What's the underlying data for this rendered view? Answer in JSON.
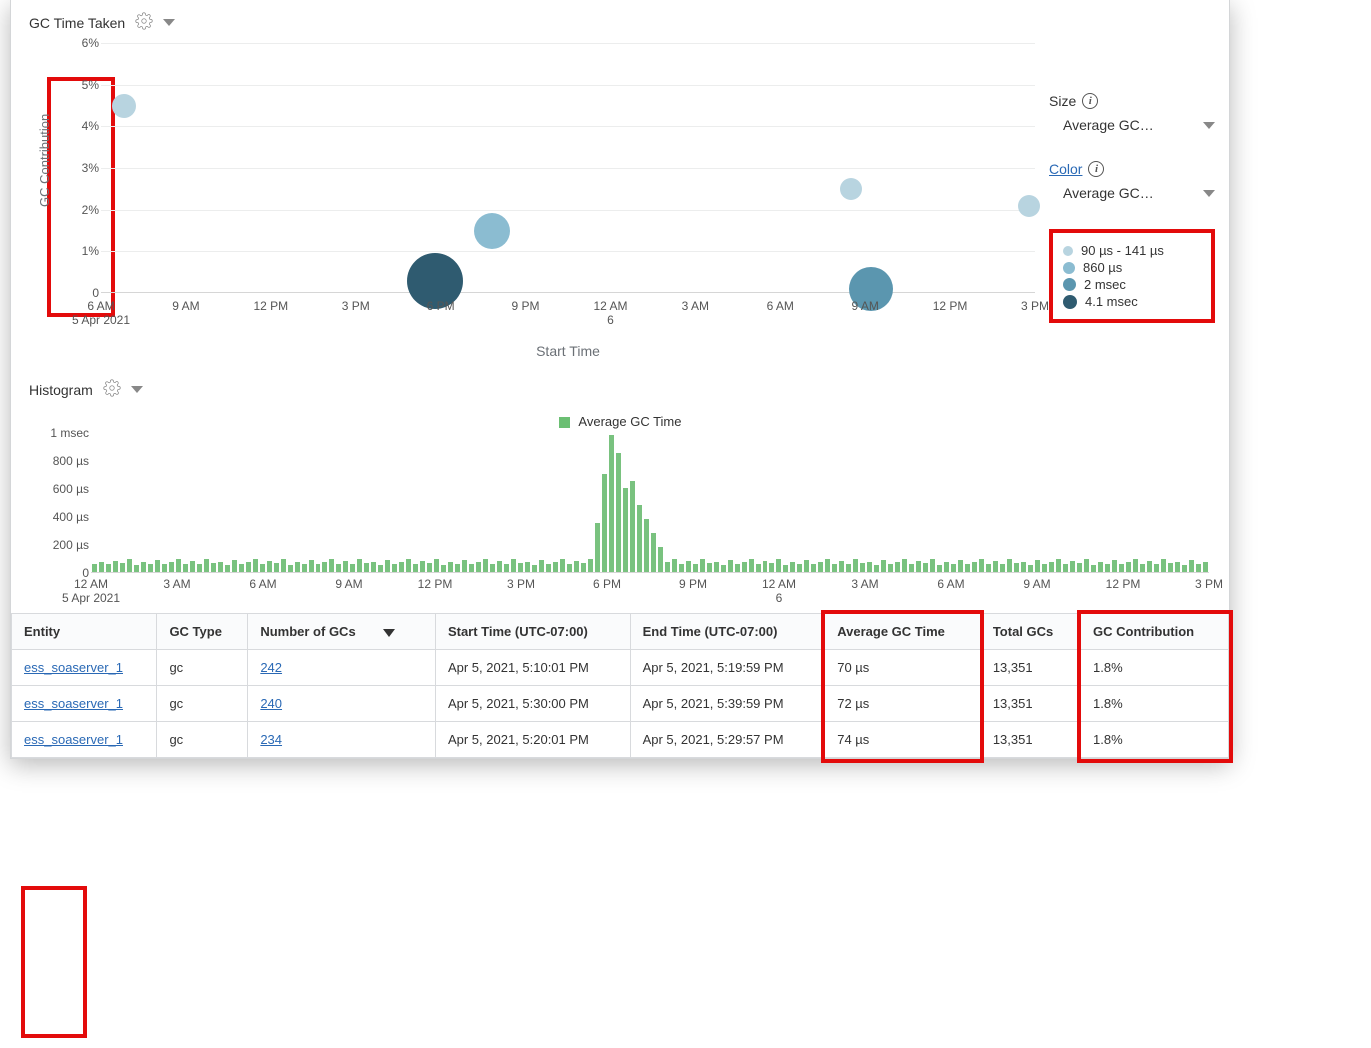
{
  "scatter": {
    "title": "GC Time Taken",
    "ylabel": "GC Contribution",
    "xlabel": "Start Time",
    "y_ticks": [
      "0",
      "1%",
      "2%",
      "3%",
      "4%",
      "5%",
      "6%"
    ],
    "x_ticks": [
      {
        "t": "6 AM",
        "sub": "5 Apr 2021"
      },
      {
        "t": "9 AM"
      },
      {
        "t": "12 PM"
      },
      {
        "t": "3 PM"
      },
      {
        "t": "6 PM"
      },
      {
        "t": "9 PM"
      },
      {
        "t": "12 AM",
        "sub": "6"
      },
      {
        "t": "3 AM"
      },
      {
        "t": "6 AM"
      },
      {
        "t": "9 AM"
      },
      {
        "t": "12 PM"
      },
      {
        "t": "3 PM"
      }
    ],
    "controls": {
      "size_label": "Size",
      "size_value": "Average GC…",
      "color_label": "Color",
      "color_value": "Average GC…"
    },
    "legend": [
      {
        "label": "90 µs - 141 µs",
        "color": "#b8d4e0",
        "size": 10
      },
      {
        "label": "860 µs",
        "color": "#8bbcd1",
        "size": 12
      },
      {
        "label": "2 msec",
        "color": "#5b96af",
        "size": 13
      },
      {
        "label": "4.1 msec",
        "color": "#2f5b70",
        "size": 14
      }
    ]
  },
  "chart_data": {
    "scatter": {
      "type": "scatter",
      "title": "GC Time Taken",
      "xlabel": "Start Time",
      "ylabel": "GC Contribution",
      "ylim": [
        0,
        6
      ],
      "x_range_hours": [
        6,
        39
      ],
      "points": [
        {
          "hour": 6.8,
          "y_pct": 4.5,
          "avg_gc_time": "90 µs",
          "color": "#b8d4e0",
          "r": 12
        },
        {
          "hour": 17.8,
          "y_pct": 0.3,
          "avg_gc_time": "4.1 msec",
          "color": "#2f5b70",
          "r": 28
        },
        {
          "hour": 19.8,
          "y_pct": 1.5,
          "avg_gc_time": "860 µs",
          "color": "#8bbcd1",
          "r": 18
        },
        {
          "hour": 32.5,
          "y_pct": 2.5,
          "avg_gc_time": "90 µs",
          "color": "#b8d4e0",
          "r": 11
        },
        {
          "hour": 33.2,
          "y_pct": 0.1,
          "avg_gc_time": "2 msec",
          "color": "#5b96af",
          "r": 22
        },
        {
          "hour": 38.8,
          "y_pct": 2.1,
          "avg_gc_time": "90 µs",
          "color": "#b8d4e0",
          "r": 11
        }
      ]
    },
    "histogram": {
      "type": "bar",
      "title": "Histogram",
      "legend": "Average GC Time",
      "ylabel": "Average GC Time",
      "y_ticks": [
        "0",
        "200 µs",
        "400 µs",
        "600 µs",
        "800 µs",
        "1 msec"
      ],
      "ylim_us": [
        0,
        1000
      ],
      "x_range_hours": [
        0,
        40
      ],
      "x_ticks": [
        {
          "t": "12 AM",
          "sub": "5 Apr 2021"
        },
        {
          "t": "3 AM"
        },
        {
          "t": "6 AM"
        },
        {
          "t": "9 AM"
        },
        {
          "t": "12 PM"
        },
        {
          "t": "3 PM"
        },
        {
          "t": "6 PM"
        },
        {
          "t": "9 PM"
        },
        {
          "t": "12 AM",
          "sub": "6"
        },
        {
          "t": "3 AM"
        },
        {
          "t": "6 AM"
        },
        {
          "t": "9 AM"
        },
        {
          "t": "12 PM"
        },
        {
          "t": "3 PM"
        }
      ],
      "values_us": [
        60,
        70,
        55,
        80,
        65,
        90,
        50,
        75,
        60,
        85,
        55,
        70,
        95,
        60,
        80,
        55,
        90,
        65,
        75,
        50,
        85,
        60,
        70,
        95,
        55,
        80,
        65,
        90,
        50,
        75,
        60,
        85,
        55,
        70,
        95,
        60,
        80,
        55,
        90,
        65,
        75,
        50,
        85,
        60,
        70,
        95,
        55,
        80,
        65,
        90,
        50,
        75,
        60,
        85,
        55,
        70,
        95,
        60,
        80,
        55,
        90,
        65,
        75,
        50,
        85,
        60,
        70,
        95,
        55,
        80,
        65,
        90,
        350,
        700,
        980,
        850,
        600,
        650,
        480,
        380,
        280,
        180,
        70,
        95,
        60,
        80,
        55,
        90,
        65,
        75,
        50,
        85,
        60,
        70,
        95,
        55,
        80,
        65,
        90,
        50,
        75,
        60,
        85,
        55,
        70,
        95,
        60,
        80,
        55,
        90,
        65,
        75,
        50,
        85,
        60,
        70,
        95,
        55,
        80,
        65,
        90,
        50,
        75,
        60,
        85,
        55,
        70,
        95,
        60,
        80,
        55,
        90,
        65,
        75,
        50,
        85,
        60,
        70,
        95,
        55,
        80,
        65,
        90,
        50,
        75,
        60,
        85,
        55,
        70,
        95,
        60,
        80,
        55,
        90,
        65,
        75,
        50,
        85,
        60,
        70
      ]
    }
  },
  "histogram_section": {
    "title": "Histogram"
  },
  "table": {
    "headers": {
      "entity": "Entity",
      "gc_type": "GC Type",
      "num_gcs": "Number of GCs",
      "start": "Start Time (UTC-07:00)",
      "end": "End Time (UTC-07:00)",
      "avg": "Average GC Time",
      "total": "Total GCs",
      "contrib": "GC Contribution"
    },
    "rows": [
      {
        "entity": "ess_soaserver_1",
        "type": "gc",
        "num": "242",
        "start": "Apr 5, 2021, 5:10:01 PM",
        "end": "Apr 5, 2021, 5:19:59 PM",
        "avg": "70 µs",
        "total": "13,351",
        "contrib": "1.8%"
      },
      {
        "entity": "ess_soaserver_1",
        "type": "gc",
        "num": "240",
        "start": "Apr 5, 2021, 5:30:00 PM",
        "end": "Apr 5, 2021, 5:39:59 PM",
        "avg": "72 µs",
        "total": "13,351",
        "contrib": "1.8%"
      },
      {
        "entity": "ess_soaserver_1",
        "type": "gc",
        "num": "234",
        "start": "Apr 5, 2021, 5:20:01 PM",
        "end": "Apr 5, 2021, 5:29:57 PM",
        "avg": "74 µs",
        "total": "13,351",
        "contrib": "1.8%"
      }
    ]
  }
}
